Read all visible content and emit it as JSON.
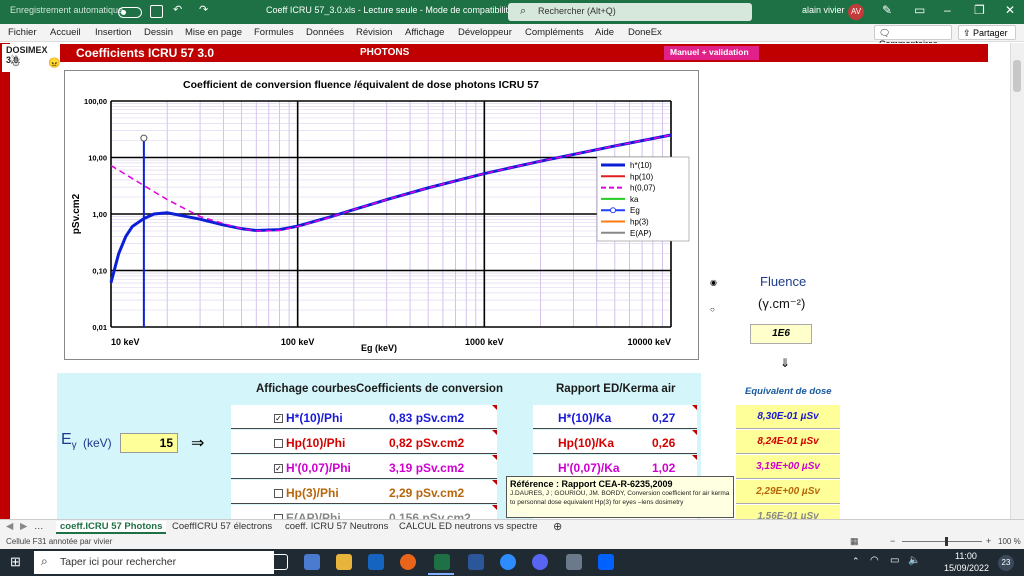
{
  "titlebar": {
    "autosave": "Enregistrement automatique",
    "doc": "Coeff ICRU 57_3.0.xls  -  Lecture seule  -  Mode de compatibilité",
    "search": "Rechercher (Alt+Q)",
    "user": "alain vivier",
    "initials": "AV"
  },
  "ribbon": {
    "items": [
      "Fichier",
      "Accueil",
      "Insertion",
      "Dessin",
      "Mise en page",
      "Formules",
      "Données",
      "Révision",
      "Affichage",
      "Développeur",
      "Compléments",
      "Aide",
      "DoneEx"
    ],
    "comments": "Commentaires",
    "share": "Partager"
  },
  "header": {
    "logo": "DOSIMEX 3.0",
    "title": "Coefficients  ICRU 57   3.0",
    "section": "PHOTONS",
    "manual": "Manuel + validation"
  },
  "chart_data": {
    "type": "line",
    "title": "Coefficient de conversion fluence /équivalent de dose photons ICRU 57",
    "xlabel": "Eg (keV)",
    "ylabel": "pSv.cm2",
    "xscale": "log",
    "yscale": "log",
    "xlim": [
      10,
      10000
    ],
    "ylim": [
      0.01,
      100
    ],
    "x_ticks": [
      "10 keV",
      "100 keV",
      "1000 keV",
      "10000 keV"
    ],
    "y_ticks": [
      "0,01",
      "0,10",
      "1,00",
      "10,00",
      "100,00"
    ],
    "legend": [
      "h*(10)",
      "hp(10)",
      "h(0,07)",
      "ka",
      "Eg",
      "hp(3)",
      "E(AP)"
    ],
    "legend_position": "right",
    "series": [
      {
        "name": "h*(10)",
        "color": "#0b1fd6",
        "x": [
          10,
          11,
          12,
          13,
          15,
          17,
          20,
          30,
          40,
          50,
          60,
          80,
          100,
          150,
          200,
          300,
          500,
          1000,
          2000,
          5000,
          10000
        ],
        "y": [
          0.061,
          0.2,
          0.4,
          0.6,
          0.83,
          1.0,
          1.05,
          0.81,
          0.64,
          0.55,
          0.51,
          0.53,
          0.61,
          0.89,
          1.2,
          1.8,
          2.9,
          5.2,
          8.6,
          16,
          25
        ]
      },
      {
        "name": "h(0,07)",
        "color": "#e000e0",
        "dash": true,
        "x": [
          10,
          15,
          20,
          30,
          40,
          50,
          60,
          80,
          100,
          150,
          200,
          300,
          500,
          1000,
          2000,
          5000,
          10000
        ],
        "y": [
          7.2,
          3.19,
          1.8,
          0.9,
          0.68,
          0.55,
          0.5,
          0.51,
          0.6,
          0.88,
          1.2,
          1.8,
          2.9,
          5.2,
          8.6,
          16,
          25
        ]
      },
      {
        "name": "Eg",
        "color": "#0b1fd6",
        "vertical_at": 15
      }
    ]
  },
  "panel": {
    "headers": {
      "affichage": "Affichage courbes",
      "coeffs": "Coefficients de conversion",
      "ratio": "Rapport ED/Kerma air",
      "eqdose": "Equivalent de dose"
    },
    "energy_label": "(keV)",
    "energy_value": "15",
    "arrow": "⇒",
    "fluence_label": "Fluence",
    "fluence_unit": "(γ.cm⁻²)",
    "fluence_value": "1E6",
    "down_arrow": "⇓",
    "rows": [
      {
        "checked": true,
        "name": "H*(10)/Phi",
        "coef": "0,83 pSv.cm2",
        "ratio_name": "H*(10)/Ka",
        "ratio": "0,27",
        "dose": "8,30E-01 µSv",
        "color": "#1a1ad6"
      },
      {
        "checked": false,
        "name": "Hp(10)/Phi",
        "coef": "0,82 pSv.cm2",
        "ratio_name": "Hp(10)/Ka",
        "ratio": "0,26",
        "dose": "8,24E-01 µSv",
        "color": "#d40000"
      },
      {
        "checked": true,
        "name": "H'(0,07)/Phi",
        "coef": "3,19 pSv.cm2",
        "ratio_name": "H'(0,07)/Ka",
        "ratio": "1,02",
        "dose": "3,19E+00 µSv",
        "color": "#d000d0"
      },
      {
        "checked": false,
        "name": "Hp(3)/Phi",
        "coef": "2,29 pSv.cm2",
        "ratio_name": "",
        "ratio": "",
        "dose": "2,29E+00 µSv",
        "color": "#b8660b"
      },
      {
        "checked": false,
        "name": "E(AP)/Phi",
        "coef": "0,156 pSv.cm2",
        "ratio_name": "",
        "ratio": "",
        "dose": "1,56E-01 µSv",
        "color": "#888888"
      }
    ],
    "tooltip": {
      "title": "Référence : Rapport CEA-R-6235,2009",
      "body": "J.DAURES, J ; GOURIOU, JM. BORDY, Conversion coefficient for air kerma to personnal dose equivalent Hp(3)  for  eyes –lens dosimetry"
    }
  },
  "tabs": [
    "coeff.ICRU 57 Photons",
    "CoeffICRU 57 électrons",
    "coeff. ICRU 57 Neutrons",
    "CALCUL ED neutrons vs spectre"
  ],
  "status": {
    "left": "Cellule F31 annotée par vivier",
    "zoom": "100 %"
  },
  "taskbar": {
    "search": "Taper ici pour rechercher",
    "temp": "23",
    "time": "11:00",
    "date": "15/09/2022"
  }
}
